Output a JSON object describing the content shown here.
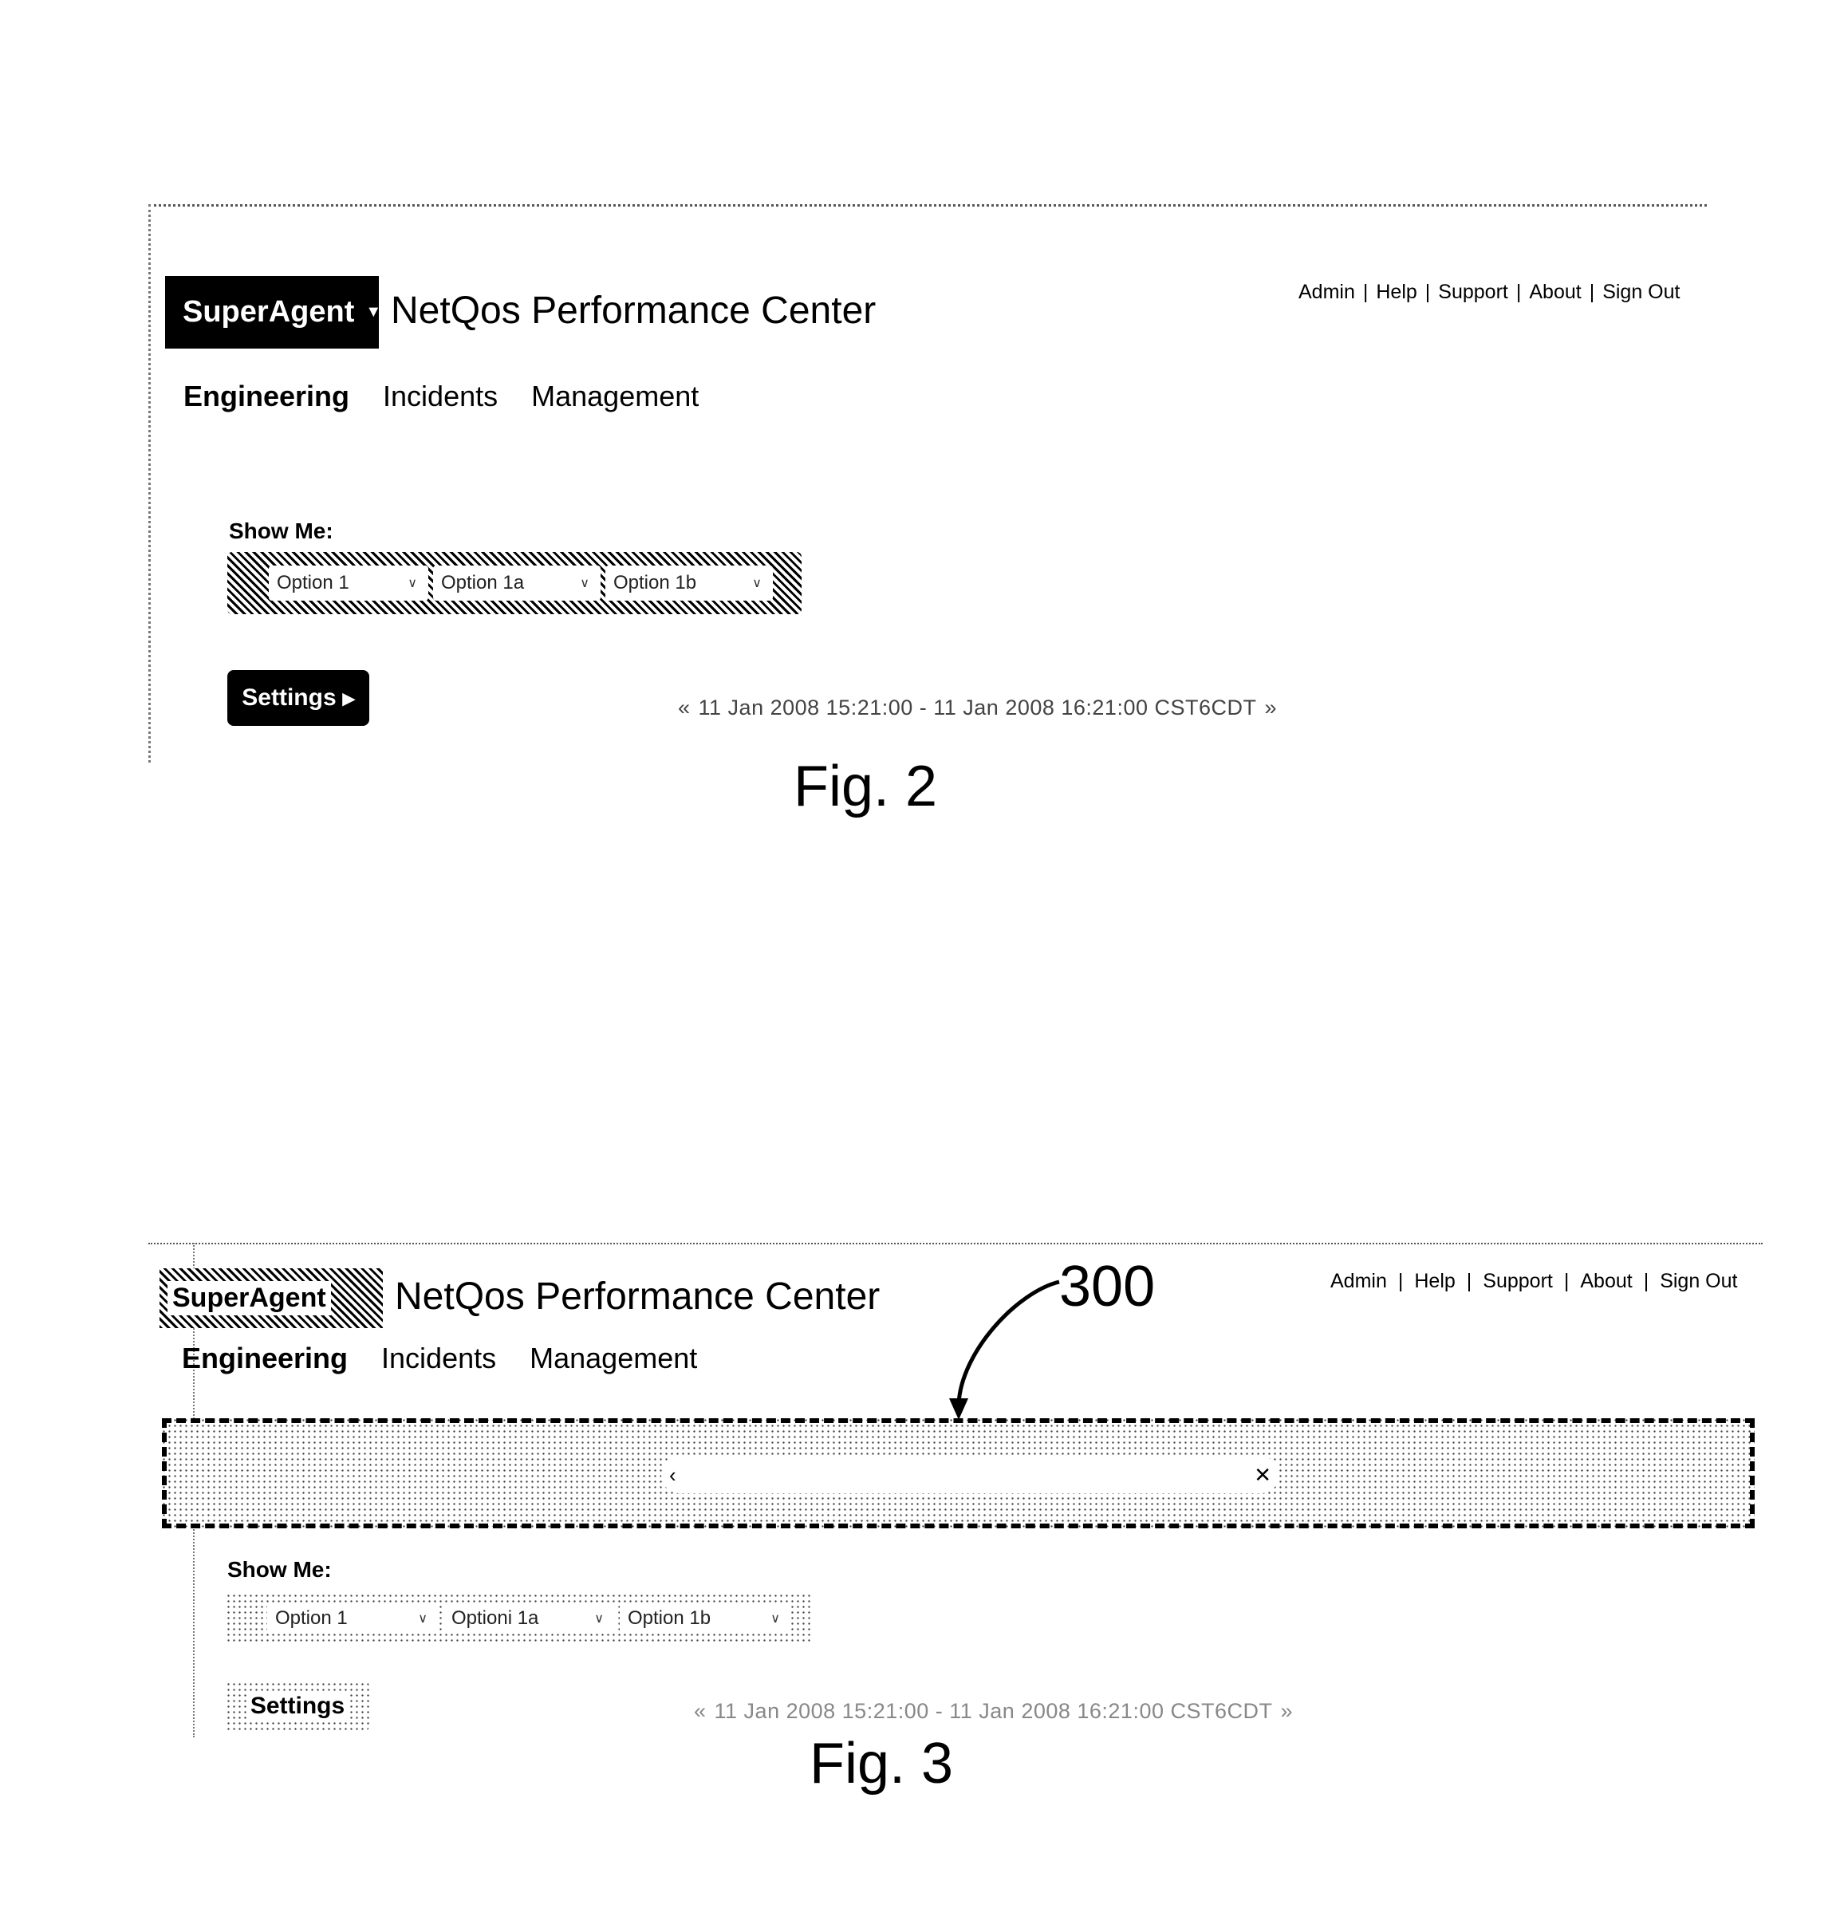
{
  "figures": [
    {
      "label": "Fig. 2",
      "brand": {
        "name": "SuperAgent",
        "dropdown_icon": "caret-down-icon"
      },
      "app_title": "NetQos Performance Center",
      "top_links": [
        "Admin",
        "Help",
        "Support",
        "About",
        "Sign Out"
      ],
      "link_separator": "|",
      "nav_tabs": [
        {
          "label": "Engineering",
          "active": true
        },
        {
          "label": "Incidents",
          "active": false
        },
        {
          "label": "Management",
          "active": false
        }
      ],
      "show_me": {
        "label": "Show Me:",
        "selects": [
          {
            "value": "Option 1"
          },
          {
            "value": "Option 1a"
          },
          {
            "value": "Option 1b"
          }
        ]
      },
      "settings_button": {
        "label": "Settings",
        "arrow": "▸"
      },
      "time_range": {
        "prev_icon": "«",
        "text": "11 Jan 2008 15:21:00 - 11 Jan 2008 16:21:00 CST6CDT",
        "next_icon": "»"
      }
    },
    {
      "label": "Fig. 3",
      "callout": "300",
      "brand": {
        "name": "SuperAgent"
      },
      "app_title": "NetQos Performance  Center",
      "top_links": [
        "Admin",
        "Help",
        "Support",
        "About",
        "Sign Out"
      ],
      "link_separator": "|",
      "nav_tabs": [
        {
          "label": "Engineering",
          "active": true
        },
        {
          "label": "Incidents",
          "active": false
        },
        {
          "label": "Management",
          "active": false
        }
      ],
      "search_bar": {
        "left_icon": "‹",
        "clear_icon": "✕",
        "value": ""
      },
      "show_me": {
        "label": "Show Me:",
        "selects": [
          {
            "value": "Option 1"
          },
          {
            "value": "Optioni 1a"
          },
          {
            "value": "Option 1b"
          }
        ]
      },
      "settings_button": {
        "label": "Settings"
      },
      "time_range": {
        "prev_icon": "«",
        "text": "11 Jan 2008 15:21:00 - 11 Jan 2008 16:21:00 CST6CDT",
        "next_icon": "»"
      }
    }
  ]
}
